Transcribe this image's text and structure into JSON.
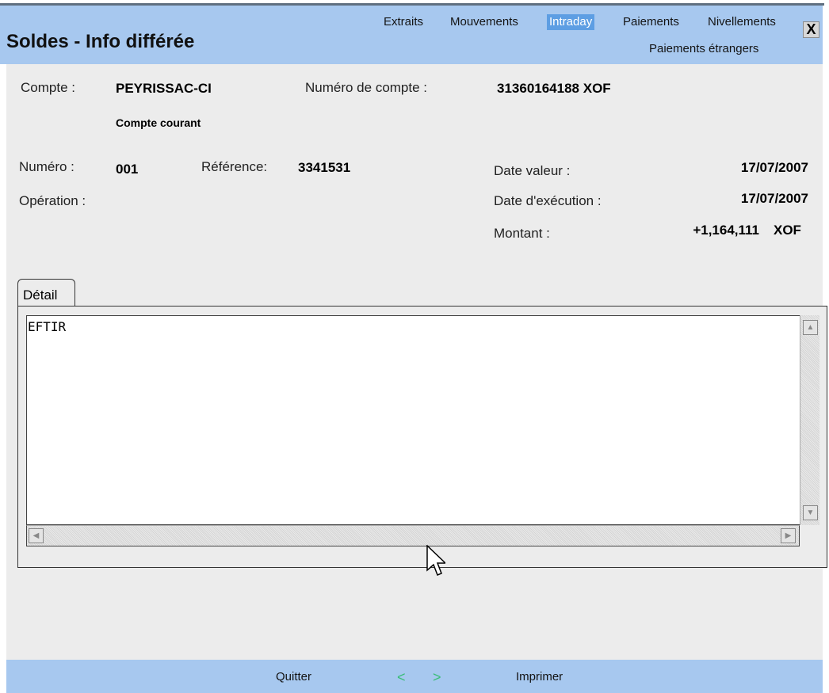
{
  "header": {
    "title": "Soldes - Info différée",
    "nav": [
      "Extraits",
      "Mouvements",
      "Intraday",
      "Paiements",
      "Nivellements",
      "Paiements étrangers"
    ],
    "active_nav": "Intraday",
    "close_label": "X"
  },
  "account": {
    "compte_label": "Compte :",
    "compte_value": "PEYRISSAC-CI",
    "compte_type": "Compte courant",
    "numero_compte_label": "Numéro de compte :",
    "numero_compte_value": "31360164188 XOF"
  },
  "operation": {
    "numero_label": "Numéro :",
    "numero_value": "001",
    "reference_label": "Référence:",
    "reference_value": "3341531",
    "operation_label": "Opération :",
    "date_valeur_label": "Date valeur :",
    "date_valeur_value": "17/07/2007",
    "date_execution_label": "Date d'exécution :",
    "date_execution_value": "17/07/2007",
    "montant_label": "Montant :",
    "montant_value": "+1,164,111",
    "montant_currency": "XOF"
  },
  "detail": {
    "tab_label": "Détail",
    "text": "EFTIR"
  },
  "footer": {
    "quit_label": "Quitter",
    "prev_label": "<",
    "next_label": ">",
    "print_label": "Imprimer"
  },
  "colors": {
    "header_bg": "#a7c8ef",
    "active_tab_bg": "#5d9ee3",
    "content_bg": "#ececec",
    "nav_arrow": "#3bbd7a"
  }
}
